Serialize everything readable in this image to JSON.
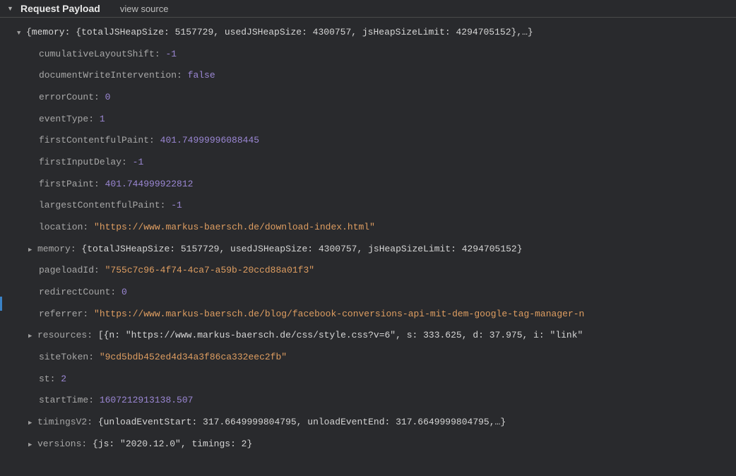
{
  "header": {
    "title": "Request Payload",
    "viewSource": "view source"
  },
  "rootSummary": "{memory: {totalJSHeapSize: 5157729, usedJSHeapSize: 4300757, jsHeapSizeLimit: 4294705152},…}",
  "props": {
    "cumulativeLayoutShift_key": "cumulativeLayoutShift",
    "cumulativeLayoutShift_val": "-1",
    "documentWriteIntervention_key": "documentWriteIntervention",
    "documentWriteIntervention_val": "false",
    "errorCount_key": "errorCount",
    "errorCount_val": "0",
    "eventType_key": "eventType",
    "eventType_val": "1",
    "firstContentfulPaint_key": "firstContentfulPaint",
    "firstContentfulPaint_val": "401.74999996088445",
    "firstInputDelay_key": "firstInputDelay",
    "firstInputDelay_val": "-1",
    "firstPaint_key": "firstPaint",
    "firstPaint_val": "401.744999922812",
    "largestContentfulPaint_key": "largestContentfulPaint",
    "largestContentfulPaint_val": "-1",
    "location_key": "location",
    "location_val": "\"https://www.markus-baersch.de/download-index.html\"",
    "memory_key": "memory",
    "memory_summary": "{totalJSHeapSize: 5157729, usedJSHeapSize: 4300757, jsHeapSizeLimit: 4294705152}",
    "pageloadId_key": "pageloadId",
    "pageloadId_val": "\"755c7c96-4f74-4ca7-a59b-20ccd88a01f3\"",
    "redirectCount_key": "redirectCount",
    "redirectCount_val": "0",
    "referrer_key": "referrer",
    "referrer_val": "\"https://www.markus-baersch.de/blog/facebook-conversions-api-mit-dem-google-tag-manager-n",
    "resources_key": "resources",
    "resources_summary": "[{n: \"https://www.markus-baersch.de/css/style.css?v=6\", s: 333.625, d: 37.975, i: \"link\"",
    "siteToken_key": "siteToken",
    "siteToken_val": "\"9cd5bdb452ed4d34a3f86ca332eec2fb\"",
    "st_key": "st",
    "st_val": "2",
    "startTime_key": "startTime",
    "startTime_val": "1607212913138.507",
    "timingsV2_key": "timingsV2",
    "timingsV2_summary": "{unloadEventStart: 317.6649999804795, unloadEventEnd: 317.6649999804795,…}",
    "versions_key": "versions",
    "versions_summary": "{js: \"2020.12.0\", timings: 2}"
  }
}
